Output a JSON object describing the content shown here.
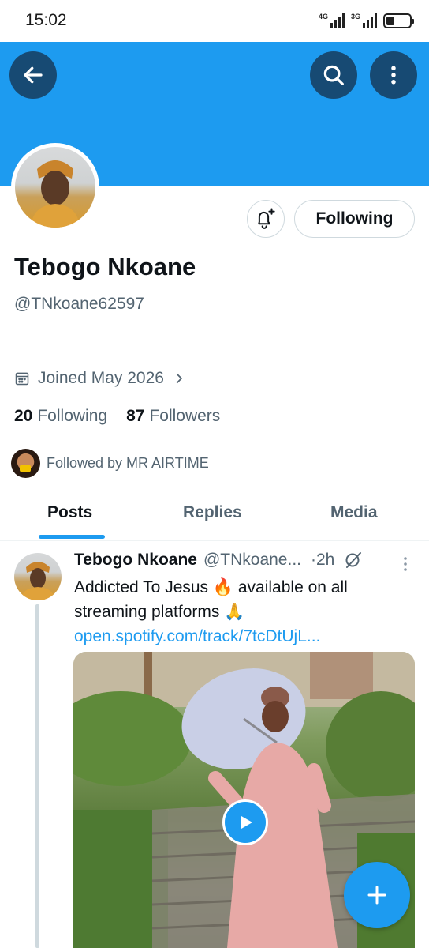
{
  "status_bar": {
    "time": "15:02",
    "network_1": "4G",
    "network_2": "3G"
  },
  "header": {
    "back_icon": "arrow-left-icon",
    "search_icon": "search-icon",
    "more_icon": "more-vertical-icon",
    "banner_color": "#1d9bf0"
  },
  "profile": {
    "name": "Tebogo Nkoane",
    "handle": "@TNkoane62597",
    "joined": "Joined May 2026",
    "following_count": "20",
    "following_label": "Following",
    "followers_count": "87",
    "followers_label": "Followers",
    "followed_by": "Followed by MR AIRTIME",
    "following_button": "Following"
  },
  "tabs": [
    {
      "label": "Posts"
    },
    {
      "label": "Replies"
    },
    {
      "label": "Media"
    }
  ],
  "post": {
    "name": "Tebogo Nkoane",
    "handle": "@TNkoane...",
    "time": "·2h",
    "text_before": "Addicted To Jesus 🔥 available on all streaming platforms 🙏 ",
    "link": "open.spotify.com/track/7tcDtUjL..."
  },
  "colors": {
    "accent": "#1d9bf0",
    "header_button": "#174a73",
    "secondary_text": "#536471"
  }
}
